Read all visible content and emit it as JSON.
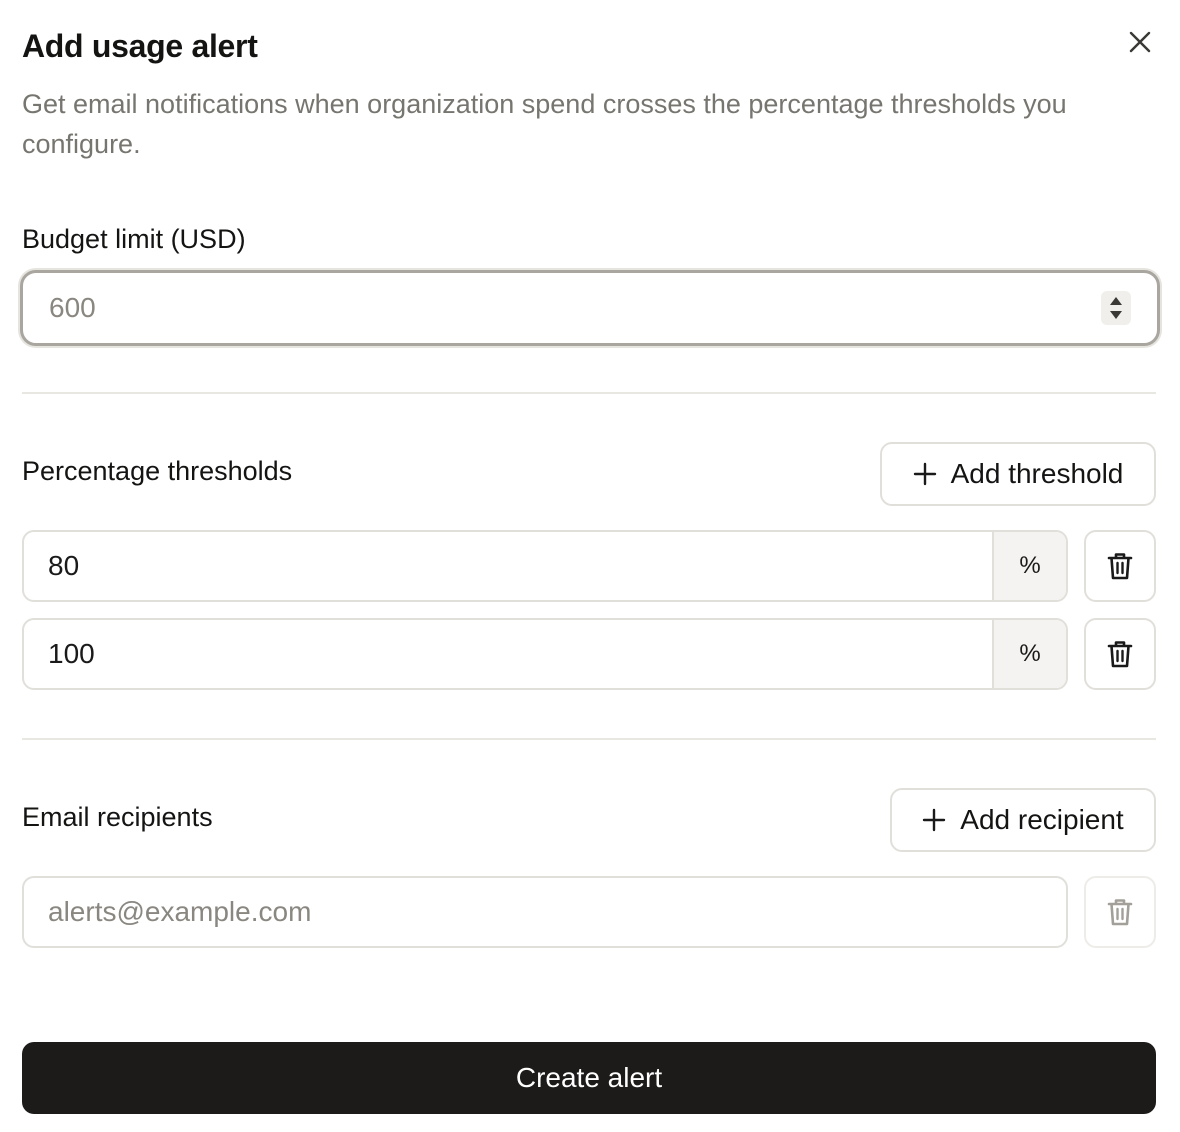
{
  "dialog": {
    "title": "Add usage alert",
    "subtitle": "Get email notifications when organization spend crosses the percentage thresholds you configure."
  },
  "budget": {
    "label": "Budget limit (USD)",
    "placeholder": "600",
    "value": ""
  },
  "thresholds": {
    "label": "Percentage thresholds",
    "add_label": "Add threshold",
    "suffix": "%",
    "items": [
      {
        "value": "80"
      },
      {
        "value": "100"
      }
    ]
  },
  "recipients": {
    "label": "Email recipients",
    "add_label": "Add recipient",
    "placeholder": "alerts@example.com"
  },
  "footer": {
    "submit_label": "Create alert"
  },
  "icons": {
    "close": "close-icon",
    "plus": "plus-icon",
    "trash": "trash-icon",
    "stepper": "stepper-arrows-icon"
  },
  "colors": {
    "primary_button": "#1c1b1a",
    "muted_text": "#77756f",
    "border": "#e1dfda"
  }
}
